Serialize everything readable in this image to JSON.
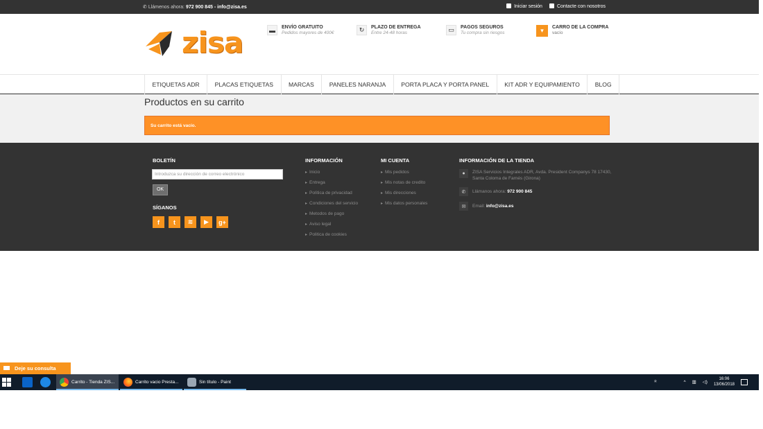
{
  "topbar": {
    "call_prefix": "Llámenos ahora:",
    "phone": "972 900 845",
    "separator": "-",
    "email": "info@zisa.es",
    "login": "Iniciar sesión",
    "contact": "Contacte con nosotros"
  },
  "logo": {
    "text": "zisa"
  },
  "header_info": [
    {
      "icon": "truck-icon",
      "title": "Envío gratuito",
      "subtitle": "Pedidos mayores de 400€"
    },
    {
      "icon": "refresh-icon",
      "title": "Plazo de entrega",
      "subtitle": "Entre 24-48 horas"
    },
    {
      "icon": "credit-card-icon",
      "title": "Pagos seguros",
      "subtitle": "Tu compra sin riesgos"
    }
  ],
  "cart": {
    "icon": "cart-icon",
    "title": "Carro de la compra",
    "status": "vacío"
  },
  "nav": {
    "items": [
      "Etiquetas ADR",
      "Placas etiquetas",
      "Marcas",
      "Paneles naranja",
      "Porta placa y porta panel",
      "Kit ADR y equipamiento",
      "Blog"
    ]
  },
  "page": {
    "title": "Productos en su carrito",
    "alert": "Su carrito está vacío."
  },
  "footer": {
    "newsletter": {
      "title": "Boletín",
      "placeholder": "Introduzca su dirección de correo electrónico",
      "button": "OK"
    },
    "follow": {
      "title": "Síganos",
      "icons": [
        "facebook-icon",
        "twitter-icon",
        "rss-icon",
        "youtube-icon",
        "google-plus-icon"
      ],
      "glyphs": [
        "f",
        "t",
        "≋",
        "▶",
        "g+"
      ]
    },
    "info": {
      "title": "Información",
      "links": [
        "Inicio",
        "Entrega",
        "Política de privacidad",
        "Condiciones del servicio",
        "Metodos de pago",
        "Aviso legal",
        "Politica de cookies"
      ]
    },
    "account": {
      "title": "Mi cuenta",
      "links": [
        "Mis pedidos",
        "Mis notas de credito",
        "Mis direcciones",
        "Mis datos personales"
      ]
    },
    "store": {
      "title": "Información de la tienda",
      "address": "ZISA Servicios Integrales ADR, Avda. President Companys 78 17430, Santa Coloma de Farnés (Girona)",
      "phone_label": "Llámanos ahora:",
      "phone": "972 900 845",
      "email_label": "Email:",
      "email": "info@zisa.es"
    }
  },
  "feedback": {
    "label": "Deje su consulta"
  },
  "taskbar": {
    "tasks": [
      {
        "label": "Carrito - Tienda ZIS...",
        "active": true
      },
      {
        "label": "Carrito vacio Presta...",
        "active": false
      },
      {
        "label": "Sin título - Paint",
        "active": false
      }
    ],
    "tray_lang": "ꞔ",
    "time": "16:06",
    "date": "13/06/2018"
  },
  "colors": {
    "accent": "#f7941d",
    "alert": "#fe9126",
    "dark": "#333333",
    "taskbar": "#101c2a"
  }
}
